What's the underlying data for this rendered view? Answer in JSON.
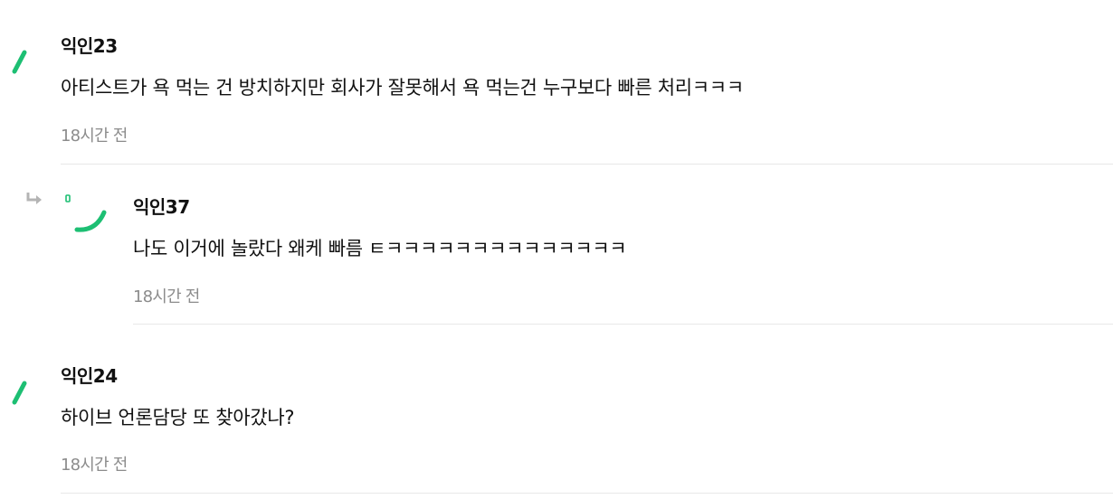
{
  "colors": {
    "accent_green": "#1dbf73",
    "text": "#111111",
    "muted": "#8c8c8c",
    "divider": "#e8e8e8",
    "reply_icon": "#b4b4b4"
  },
  "comments": [
    {
      "author": "익인23",
      "text": "아티스트가 욕 먹는 건 방치하지만 회사가 잘못해서 욕 먹는건 누구보다 빠른 처리ㅋㅋㅋ",
      "time": "18시간 전",
      "avatar_icon": "green-slash-icon"
    },
    {
      "author": "익인37",
      "text": "나도 이거에 놀랐다 왜케 빠름 ㅌㅋㅋㅋㅋㅋㅋㅋㅋㅋㅋㅋㅋㅋㅋ",
      "time": "18시간 전",
      "avatar_icon": "green-smile-icon",
      "is_reply": true,
      "reply_icon": "reply-arrow-icon"
    },
    {
      "author": "익인24",
      "text": "하이브 언론담당 또 찾아갔나?",
      "time": "18시간 전",
      "avatar_icon": "green-slash-icon"
    }
  ]
}
